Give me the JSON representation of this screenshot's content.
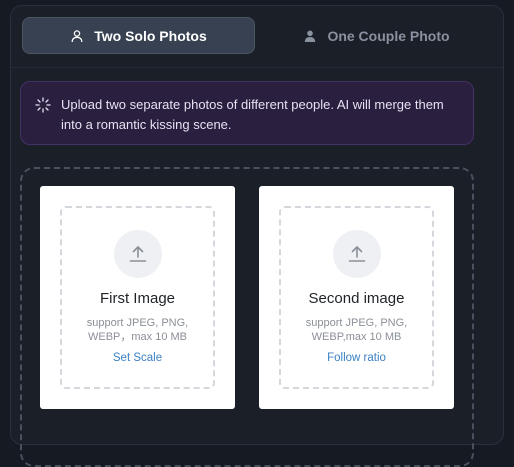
{
  "tabs": [
    {
      "label": "Two Solo Photos",
      "icon": "person-outline-icon",
      "active": true
    },
    {
      "label": "One Couple Photo",
      "icon": "person-filled-icon",
      "active": false
    }
  ],
  "info": {
    "icon": "sparkle-icon",
    "text": "Upload two separate photos of different people. AI will merge them into a romantic kissing scene."
  },
  "uploads": [
    {
      "title": "First Image",
      "support_line1": "support JPEG, PNG,",
      "support_line2": "WEBP，max 10 MB",
      "link": "Set Scale"
    },
    {
      "title": "Second image",
      "support_line1": "support JPEG, PNG,",
      "support_line2": "WEBP,max 10 MB",
      "link": "Follow ratio"
    }
  ],
  "colors": {
    "background": "#161a22",
    "active_tab": "#374151",
    "info_bg": "#2a1f3f",
    "link": "#3b82c4"
  }
}
